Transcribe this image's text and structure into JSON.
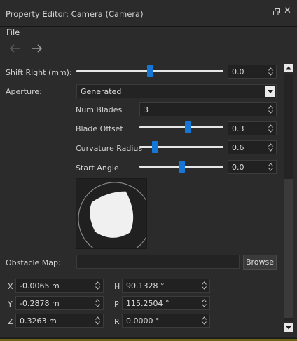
{
  "window": {
    "title": "Property Editor: Camera (Camera)"
  },
  "menu": {
    "file": "File"
  },
  "properties": {
    "shift_right": {
      "label": "Shift Right (mm):",
      "value": "0.0",
      "slider_fraction": 0.5
    },
    "aperture": {
      "label": "Aperture:",
      "value": "Generated"
    },
    "num_blades": {
      "label": "Num Blades",
      "value": "3"
    },
    "blade_offset": {
      "label": "Blade Offset",
      "value": "0.3",
      "slider_fraction": 0.59
    },
    "curvature_radius": {
      "label": "Curvature Radius",
      "value": "0.6",
      "slider_fraction": 0.16
    },
    "start_angle": {
      "label": "Start Angle",
      "value": "0.0",
      "slider_fraction": 0.5
    },
    "obstacle_map": {
      "label": "Obstacle Map:",
      "value": "",
      "browse": "Browse"
    }
  },
  "transform": {
    "x": {
      "label": "X",
      "value": "-0.0065 m"
    },
    "y": {
      "label": "Y",
      "value": "-0.2878 m"
    },
    "z": {
      "label": "Z",
      "value": "0.3263 m"
    },
    "h": {
      "label": "H",
      "value": "90.1328 °"
    },
    "p": {
      "label": "P",
      "value": "115.2504 °"
    },
    "r": {
      "label": "R",
      "value": "0.0000 °"
    }
  },
  "colors": {
    "accent": "#1676d6",
    "panel": "#2b2b2b",
    "field": "#212121"
  }
}
